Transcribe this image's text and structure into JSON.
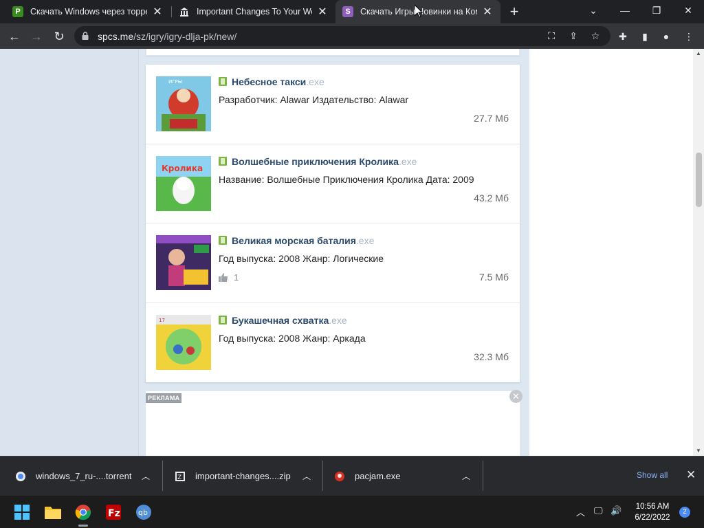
{
  "browser": {
    "tabs": [
      {
        "title": "Скачать Windows через торрен",
        "favicon": "torrent-icon",
        "favicon_color": "#3a8c1e"
      },
      {
        "title": "Important Changes To Your Wells",
        "favicon": "bank-icon",
        "favicon_color": "#cfcfcf"
      },
      {
        "title": "Скачать Игры Новинки на Комп",
        "favicon": "spcs-icon",
        "favicon_color": "#8e5fbd",
        "active": true
      }
    ],
    "url_host": "spcs.me",
    "url_path": "/sz/igry/igry-dlja-pk/new/"
  },
  "games": [
    {
      "name": "Небесное такси",
      "ext": ".exe",
      "desc": "Разработчик: Alawar Издательство: Alawar",
      "size": "27.7 Мб",
      "likes": null
    },
    {
      "name": "Волшебные приключения Кролика",
      "ext": ".exe",
      "desc": "Название: Волшебные Приключения Кролика Дата: 2009",
      "size": "43.2 Мб",
      "likes": null
    },
    {
      "name": "Великая морская баталия",
      "ext": ".exe",
      "desc": "Год выпуска: 2008 Жанр: Логические",
      "size": "7.5 Мб",
      "likes": "1"
    },
    {
      "name": "Букашечная схватка",
      "ext": ".exe",
      "desc": "Год выпуска: 2008 Жанр: Аркада",
      "size": "32.3 Мб",
      "likes": null
    }
  ],
  "ad": {
    "label": "РЕКЛАМА"
  },
  "downloads": {
    "items": [
      {
        "name": "windows_7_ru-....torrent",
        "icon": "torrent-file-icon"
      },
      {
        "name": "important-changes....zip",
        "icon": "zip-file-icon"
      },
      {
        "name": "pacjam.exe",
        "icon": "exe-file-icon"
      }
    ],
    "show_all": "Show all"
  },
  "taskbar": {
    "time": "10:56 AM",
    "date": "6/22/2022",
    "notifications": "2"
  }
}
